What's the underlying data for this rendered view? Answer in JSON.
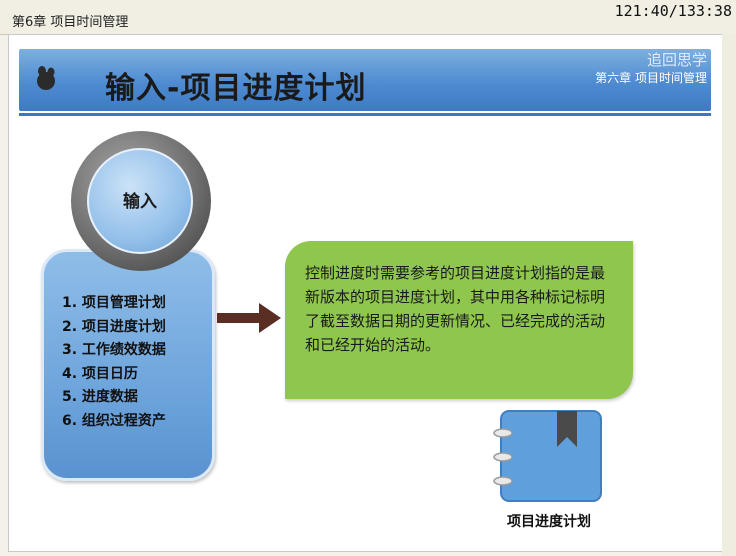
{
  "header": {
    "chapter_label": "第6章 项目时间管理",
    "page_counter": "121:40/133:38"
  },
  "banner": {
    "title": "输入-项目进度计划",
    "logo_text": "追回思学",
    "chapter_label": "第六章 项目时间管理"
  },
  "circle": {
    "label": "输入"
  },
  "inputs": {
    "items": [
      "1. 项目管理计划",
      "2. 项目进度计划",
      "3. 工作绩效数据",
      "4. 项目日历",
      "5. 进度数据",
      "6. 组织过程资产"
    ]
  },
  "description": {
    "text": "控制进度时需要参考的项目进度计划指的是最新版本的项目进度计划，其中用各种标记标明了截至数据日期的更新情况、已经完成的活动和已经开始的活动。"
  },
  "notebook": {
    "label": "项目进度计划"
  },
  "colors": {
    "banner": "#4e8bd1",
    "input_box": "#6ea5dc",
    "green_box": "#8fc64e",
    "arrow": "#5a2e22",
    "notebook": "#5fa0dc"
  }
}
